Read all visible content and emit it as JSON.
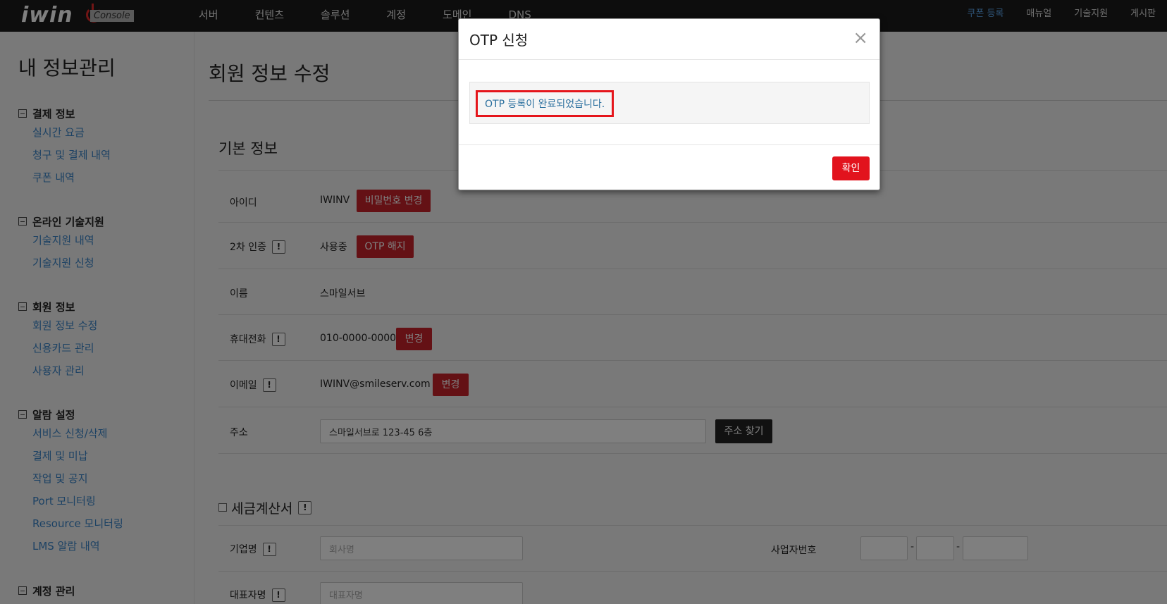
{
  "topnav": {
    "logo": "iwin",
    "console_badge": "Console",
    "menu": [
      "서버",
      "컨텐츠",
      "솔루션",
      "계정",
      "도메인",
      "DNS"
    ],
    "right_menu": [
      "쿠폰 등록",
      "매뉴얼",
      "기술지원",
      "게시판"
    ]
  },
  "sidebar": {
    "title": "내 정보관리",
    "groups": [
      {
        "header": "결제 정보",
        "items": [
          "실시간 요금",
          "청구 및 결제 내역",
          "쿠폰 내역"
        ]
      },
      {
        "header": "온라인 기술지원",
        "items": [
          "기술지원 내역",
          "기술지원 신청"
        ]
      },
      {
        "header": "회원 정보",
        "items": [
          "회원 정보 수정",
          "신용카드 관리",
          "사용자 관리"
        ]
      },
      {
        "header": "알람 설정",
        "items": [
          "서비스 신청/삭제",
          "결제 및 미납",
          "작업 및 공지",
          "Port 모니터링",
          "Resource 모니터링",
          "LMS 알람 내역"
        ]
      },
      {
        "header": "계정 관리",
        "items": []
      }
    ]
  },
  "main": {
    "page_title": "회원 정보 수정",
    "basic_section_title": "기본 정보",
    "rows": {
      "id": {
        "label": "아이디",
        "value": "IWINV",
        "button": "비밀번호 변경"
      },
      "auth": {
        "label": "2차 인증",
        "value": "사용중",
        "button": "OTP 해지"
      },
      "name": {
        "label": "이름",
        "value": "스마일서브"
      },
      "phone": {
        "label": "휴대전화",
        "value": "010-0000-0000",
        "button": "변경"
      },
      "email": {
        "label": "이메일",
        "value": "IWINV@smileserv.com",
        "button": "변경"
      },
      "address": {
        "label": "주소",
        "value": "스마일서브로 123-45 6층",
        "button": "주소 찾기"
      }
    },
    "tax": {
      "title": "세금계산서",
      "company_label": "기업명",
      "company_placeholder": "회사명",
      "bizno_label": "사업자번호",
      "ceo_label": "대표자명",
      "ceo_placeholder": "대표자명",
      "dash": "-"
    },
    "info_mark": "!"
  },
  "modal": {
    "title": "OTP 신청",
    "close": "×",
    "message": "OTP 등록이 완료되었습니다.",
    "ok_button": "확인"
  }
}
